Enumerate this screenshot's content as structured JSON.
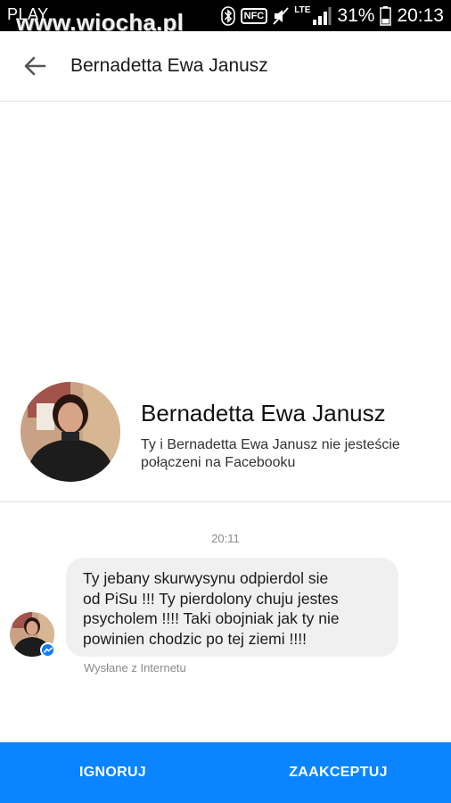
{
  "status_bar": {
    "carrier": "PLAY",
    "watermark": "www.wiocha.pl",
    "nfc": "NFC",
    "network": "LTE",
    "battery_percent": "31%",
    "time": "20:13",
    "icons": [
      "bluetooth-icon",
      "nfc-icon",
      "mute-icon",
      "lte-signal-icon",
      "battery-icon"
    ]
  },
  "header": {
    "title": "Bernadetta Ewa Janusz",
    "back_icon": "arrow-left-icon"
  },
  "profile": {
    "name": "Bernadetta Ewa Janusz",
    "subtitle": "Ty i Bernadetta Ewa Janusz nie jesteście połączeni na Facebooku"
  },
  "conversation": {
    "timestamp": "20:11",
    "message": {
      "lines": [
        "Ty jebany skurwysynu odpierdol sie",
        "od PiSu !!! Ty pierdolony chuju jestes",
        "psycholem !!!! Taki obojniak jak ty nie",
        "powinien chodzic po tej ziemi !!!!"
      ],
      "sent_via": "Wysłane z Internetu"
    }
  },
  "actions": {
    "ignore_label": "IGNORUJ",
    "accept_label": "ZAAKCEPTUJ"
  },
  "colors": {
    "accent": "#0a84ff",
    "bubble": "#f1f0f0",
    "status_bar": "#000000"
  }
}
